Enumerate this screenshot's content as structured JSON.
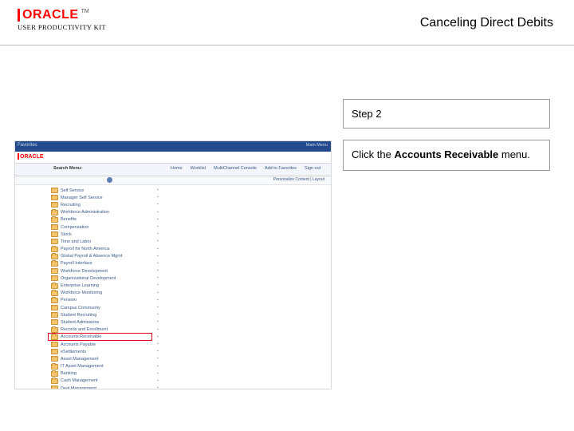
{
  "header": {
    "logo_text": "ORACLE",
    "logo_subtitle": "USER PRODUCTIVITY KIT",
    "tm": "TM",
    "title": "Canceling Direct Debits"
  },
  "instructions": {
    "step_label": "Step 2",
    "text_prefix": "Click the ",
    "text_bold": "Accounts Receivable",
    "text_suffix": " menu."
  },
  "screenshot": {
    "topbar": {
      "left": "Favorites",
      "right": [
        "Main Menu"
      ]
    },
    "toolbar": {
      "search_label": "Search Menu:",
      "links": [
        "Home",
        "Worklist",
        "MultiChannel Console",
        "Add to Favorites",
        "Sign out"
      ]
    },
    "subbar": {
      "personalize": "Personalize Content | Layout"
    },
    "menu": [
      {
        "label": "Self Service",
        "sub": true
      },
      {
        "label": "Manager Self Service",
        "sub": true
      },
      {
        "label": "Recruiting",
        "sub": true
      },
      {
        "label": "Workforce Administration",
        "sub": true
      },
      {
        "label": "Benefits",
        "sub": true
      },
      {
        "label": "Compensation",
        "sub": true
      },
      {
        "label": "Stock",
        "sub": true
      },
      {
        "label": "Time and Labor",
        "sub": true
      },
      {
        "label": "Payroll for North America",
        "sub": true
      },
      {
        "label": "Global Payroll & Absence Mgmt",
        "sub": true
      },
      {
        "label": "Payroll Interface",
        "sub": true
      },
      {
        "label": "Workforce Development",
        "sub": true
      },
      {
        "label": "Organizational Development",
        "sub": true
      },
      {
        "label": "Enterprise Learning",
        "sub": true
      },
      {
        "label": "Workforce Monitoring",
        "sub": true
      },
      {
        "label": "Pension",
        "sub": true
      },
      {
        "label": "Campus Community",
        "sub": true
      },
      {
        "label": "Student Recruiting",
        "sub": true
      },
      {
        "label": "Student Admissions",
        "sub": true
      },
      {
        "label": "Records and Enrollment",
        "sub": true
      },
      {
        "label": "Accounts Receivable",
        "sub": true,
        "highlighted": true
      },
      {
        "label": "Accounts Payable",
        "sub": true
      },
      {
        "label": "eSettlements",
        "sub": true
      },
      {
        "label": "Asset Management",
        "sub": true
      },
      {
        "label": "IT Asset Management",
        "sub": true
      },
      {
        "label": "Banking",
        "sub": true
      },
      {
        "label": "Cash Management",
        "sub": true
      },
      {
        "label": "Deal Management",
        "sub": true
      }
    ]
  }
}
